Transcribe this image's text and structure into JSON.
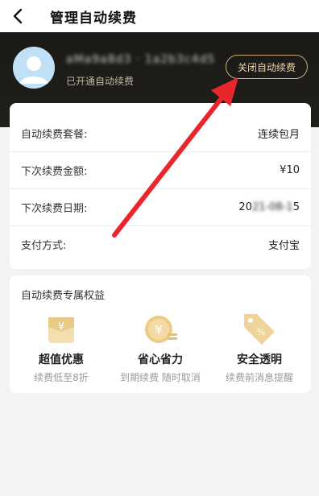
{
  "nav": {
    "title": "管理自动续费"
  },
  "header": {
    "username": "aMa9a8d3 · 1a2b3c4d5",
    "status": "已开通自动续费",
    "close_button": "关闭自动续费"
  },
  "details": [
    {
      "label": "自动续费套餐:",
      "value": "连续包月"
    },
    {
      "label": "下次续费金额:",
      "value": "¥10"
    },
    {
      "label": "下次续费日期:",
      "value_prefix": "20",
      "value_masked": "21-08-1",
      "value_suffix": "5"
    },
    {
      "label": "支付方式:",
      "value": "支付宝"
    }
  ],
  "benefits": {
    "title": "自动续费专属权益",
    "items": [
      {
        "icon": "gift-card-icon",
        "title": "超值优惠",
        "subtitle": "续费低至8折"
      },
      {
        "icon": "yen-coin-icon",
        "title": "省心省力",
        "subtitle": "到期续费 随时取消"
      },
      {
        "icon": "price-tag-icon",
        "title": "安全透明",
        "subtitle": "续费前消息提醒"
      }
    ]
  },
  "colors": {
    "header_bg": "#1b1916",
    "accent_gold": "#c9ac75",
    "annotation_red": "#e8262b"
  }
}
